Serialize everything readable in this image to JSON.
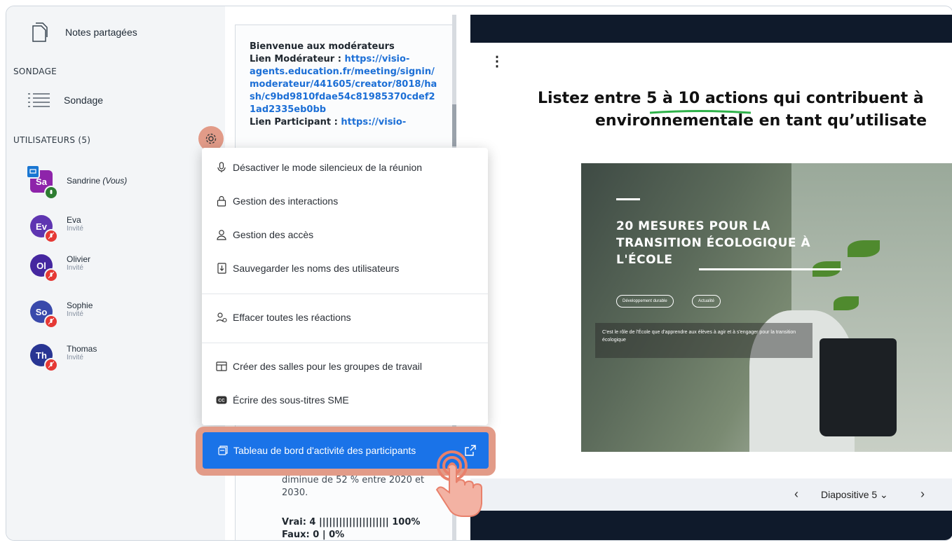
{
  "sidebar": {
    "shared_notes": "Notes partagées",
    "poll_section": "SONDAGE",
    "poll_item": "Sondage",
    "users_section": "UTILISATEURS (5)",
    "users": [
      {
        "initials": "Sa",
        "name": "Sandrine",
        "suffix": "(Vous)",
        "role": "",
        "color": "#8e24aa"
      },
      {
        "initials": "Ev",
        "name": "Eva",
        "suffix": "",
        "role": "Invité",
        "color": "#5e35b1"
      },
      {
        "initials": "Ol",
        "name": "Olivier",
        "suffix": "",
        "role": "Invité",
        "color": "#4527a0"
      },
      {
        "initials": "So",
        "name": "Sophie",
        "suffix": "",
        "role": "Invité",
        "color": "#3949ab"
      },
      {
        "initials": "Th",
        "name": "Thomas",
        "suffix": "",
        "role": "Invité",
        "color": "#283593"
      }
    ]
  },
  "chat": {
    "welcome": "Bienvenue aux modérateurs",
    "mod_label": "Lien Modérateur  : ",
    "mod_link_lines": [
      "https://visio-",
      "agents.education.fr/meeting/signin/",
      "moderateur/441605/creator/8018/ha",
      "sh/c9bd9810fdae54c81985370cdef2",
      "1ad2335eb0bb"
    ],
    "part_label": "Lien Participant  : ",
    "part_link": "https://visio-",
    "lower_lines": [
      "diminue de 52 % entre 2020 et",
      "2030."
    ],
    "true_line": "Vrai: 4 ||||||||||||||||||||| 100%",
    "false_line": "Faux: 0 | 0%"
  },
  "menu": {
    "items": [
      "Désactiver le mode silencieux de la réunion",
      "Gestion des interactions",
      "Gestion des accès",
      "Sauvegarder les noms des utilisateurs",
      "Effacer toutes les réactions",
      "Créer des salles pour les groupes de travail",
      "Écrire des sous-titres SME"
    ],
    "highlighted": "Tableau de bord d'activité des participants"
  },
  "presentation": {
    "kebab": "⋮",
    "title_line1": "Listez entre 5 à 10 actions qui contribuent à",
    "title_line2": "environnementale en tant qu’utilisate",
    "image_heading": [
      "20 MESURES POUR LA",
      "TRANSITION ÉCOLOGIQUE À",
      "L'ÉCOLE"
    ],
    "chips": [
      "Développement durable",
      "Actualité"
    ],
    "image_caption": "C'est le rôle de l'École que d'apprendre aux élèves à agir et à s'engager pour la transition écologique",
    "slide_label": "Diapositive 5"
  },
  "colors": {
    "accent": "#1a73e8",
    "highlight": "#e29b88",
    "dark_bar": "#0f1a2b",
    "badge_red": "#e53935",
    "badge_green": "#2e7d32"
  }
}
